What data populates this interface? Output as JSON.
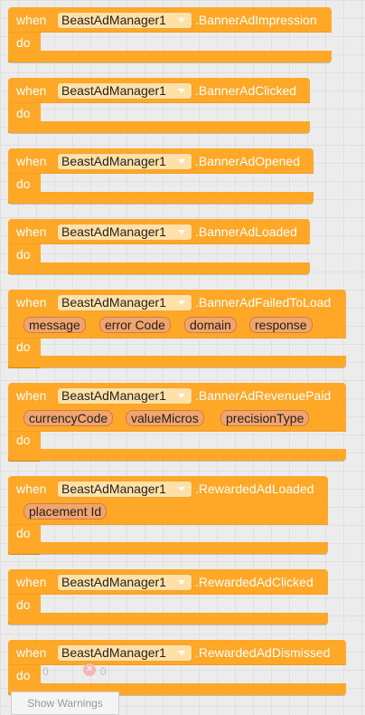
{
  "keywords": {
    "when": "when",
    "do": "do"
  },
  "component": "BeastAdManager1",
  "blocks": [
    {
      "event": ".BannerAdImpression",
      "params": []
    },
    {
      "event": ".BannerAdClicked",
      "params": []
    },
    {
      "event": ".BannerAdOpened",
      "params": []
    },
    {
      "event": ".BannerAdLoaded",
      "params": []
    },
    {
      "event": ".BannerAdFailedToLoad",
      "params": [
        "message",
        "error Code",
        "domain",
        "response"
      ]
    },
    {
      "event": ".BannerAdRevenuePaid",
      "params": [
        "currencyCode",
        "valueMicros",
        "precisionType"
      ]
    },
    {
      "event": ".RewardedAdLoaded",
      "params": [
        "placement Id"
      ]
    },
    {
      "event": ".RewardedAdClicked",
      "params": []
    },
    {
      "event": ".RewardedAdDismissed",
      "params": []
    }
  ],
  "warnings": {
    "warning_count": "0",
    "error_count": "0",
    "show_warnings_label": "Show Warnings"
  },
  "colors": {
    "event_block": "#ffa726",
    "param_chip": "#f1a56c",
    "component_dropdown": "#ffe0a6"
  }
}
